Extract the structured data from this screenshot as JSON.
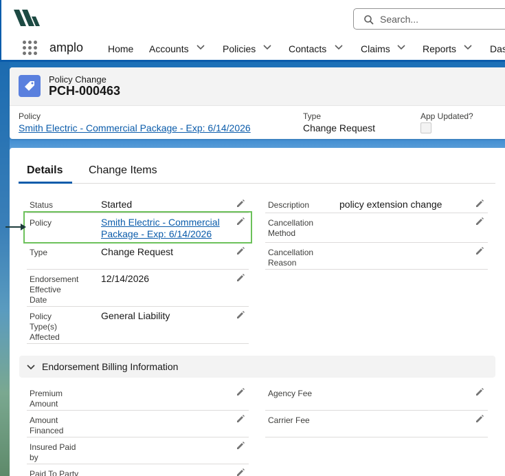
{
  "brand": {
    "logo": "amplo-logo"
  },
  "search": {
    "placeholder": "Search..."
  },
  "app": {
    "name": "amplo"
  },
  "nav": {
    "items": [
      {
        "label": "Home",
        "has_menu": false
      },
      {
        "label": "Accounts",
        "has_menu": true
      },
      {
        "label": "Policies",
        "has_menu": true
      },
      {
        "label": "Contacts",
        "has_menu": true
      },
      {
        "label": "Claims",
        "has_menu": true
      },
      {
        "label": "Reports",
        "has_menu": true
      },
      {
        "label": "Dash",
        "has_menu": false
      }
    ]
  },
  "record": {
    "object_type": "Policy Change",
    "name": "PCH-000463",
    "icon": "tag-icon",
    "highlights": {
      "policy_label": "Policy",
      "policy_value": "Smith Electric - Commercial Package - Exp: 6/14/2026",
      "type_label": "Type",
      "type_value": "Change Request",
      "app_updated_label": "App Updated?",
      "app_updated_checked": false
    }
  },
  "tabs": [
    {
      "label": "Details",
      "active": true
    },
    {
      "label": "Change Items",
      "active": false
    }
  ],
  "details": {
    "left": [
      {
        "label": "Status",
        "value": "Started",
        "link": false
      },
      {
        "label": "Policy",
        "value_line1": "Smith Electric - Commercial",
        "value_line2": "Package - Exp: 6/14/2026",
        "link": true
      },
      {
        "label": "Type",
        "value": "Change Request",
        "link": false
      },
      {
        "label_line1": "Endorsement",
        "label_line2": "Effective",
        "label_line3": "Date",
        "value": "12/14/2026",
        "link": false
      },
      {
        "label_line1": "Policy",
        "label_line2": "Type(s)",
        "label_line3": "Affected",
        "value": "General Liability",
        "link": false
      }
    ],
    "right": [
      {
        "label": "Description",
        "value": "policy extension change"
      },
      {
        "label_line1": "Cancellation",
        "label_line2": "Method",
        "value": ""
      },
      {
        "label_line1": "Cancellation",
        "label_line2": "Reason",
        "value": ""
      }
    ]
  },
  "billing": {
    "section_title": "Endorsement Billing Information",
    "left": [
      {
        "label_line1": "Premium",
        "label_line2": "Amount"
      },
      {
        "label_line1": "Amount",
        "label_line2": "Financed"
      },
      {
        "label_line1": "Insured Paid",
        "label_line2": "by"
      },
      {
        "label_line1": "Paid To Party"
      }
    ],
    "right": [
      {
        "label": "Agency Fee"
      },
      {
        "label": "Carrier Fee"
      }
    ]
  },
  "colors": {
    "brand_blue": "#0b5cab",
    "highlight_green": "#6cc15a",
    "object_icon": "#5a80de",
    "logo": "#1d4a43"
  }
}
